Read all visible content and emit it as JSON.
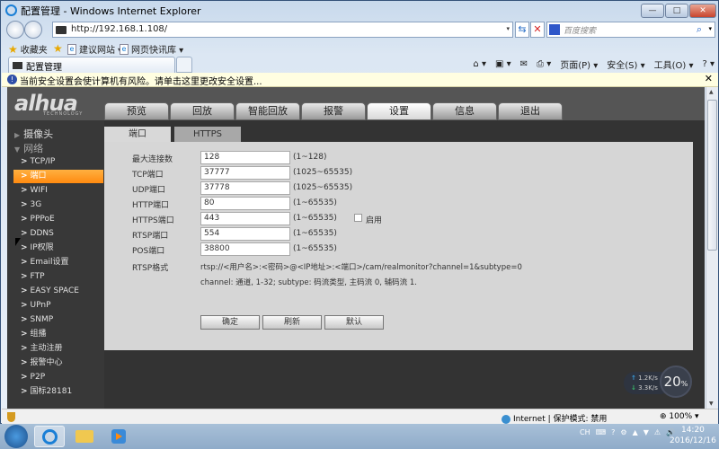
{
  "window": {
    "title": "配置管理 - Windows Internet Explorer",
    "min_label": "—",
    "max_label": "□",
    "close_label": "✕"
  },
  "nav": {
    "back_icon": "◀",
    "forward_icon": "▶",
    "url": "http://192.168.1.108/",
    "dropdown": "▾",
    "refresh_icon": "⇆",
    "stop_icon": "✕",
    "search_placeholder": "百度搜索",
    "search_icon": "⌕"
  },
  "favorites": {
    "favorites_label": "收藏夹",
    "items": [
      {
        "label": "建议网站 ▾"
      },
      {
        "label": "网页快讯库 ▾"
      }
    ]
  },
  "tab": {
    "title": "配置管理"
  },
  "command_bar": {
    "home": "⌂ ▾",
    "feeds": "▣ ▾",
    "mail": "✉",
    "print": "⎙ ▾",
    "page": "页面(P) ▾",
    "safety": "安全(S) ▾",
    "tools": "工具(O) ▾",
    "help": "? ▾"
  },
  "infobar": {
    "icon": "!",
    "text": "当前安全设置会使计算机有风险。请单击这里更改安全设置...",
    "close": "✕"
  },
  "app": {
    "logo": "alhua",
    "logo_sub": "TECHNOLOGY",
    "top_nav": [
      {
        "label": "预览",
        "active": false
      },
      {
        "label": "回放",
        "active": false
      },
      {
        "label": "智能回放",
        "active": false
      },
      {
        "label": "报警",
        "active": false
      },
      {
        "label": "设置",
        "active": true
      },
      {
        "label": "信息",
        "active": false
      },
      {
        "label": "退出",
        "active": false
      }
    ],
    "sidebar": {
      "sections": [
        {
          "label": "摄像头",
          "icon": "▶"
        },
        {
          "label": "网络",
          "icon": "▼"
        }
      ],
      "items": [
        {
          "label": "TCP/IP",
          "active": false
        },
        {
          "label": "端口",
          "active": true
        },
        {
          "label": "WIFI",
          "active": false
        },
        {
          "label": "3G",
          "active": false
        },
        {
          "label": "PPPoE",
          "active": false
        },
        {
          "label": "DDNS",
          "active": false
        },
        {
          "label": "IP权限",
          "active": false
        },
        {
          "label": "Email设置",
          "active": false
        },
        {
          "label": "FTP",
          "active": false
        },
        {
          "label": "EASY SPACE",
          "active": false
        },
        {
          "label": "UPnP",
          "active": false
        },
        {
          "label": "SNMP",
          "active": false
        },
        {
          "label": "组播",
          "active": false
        },
        {
          "label": "主动注册",
          "active": false
        },
        {
          "label": "报警中心",
          "active": false
        },
        {
          "label": "P2P",
          "active": false
        },
        {
          "label": "国标28181",
          "active": false
        }
      ],
      "chevron": ">"
    },
    "sub_tabs": [
      {
        "label": "端口",
        "active": true
      },
      {
        "label": "HTTPS",
        "active": false
      }
    ],
    "form": {
      "rows": [
        {
          "label": "最大连接数",
          "value": "128",
          "range": "(1~128)"
        },
        {
          "label": "TCP端口",
          "value": "37777",
          "range": "(1025~65535)"
        },
        {
          "label": "UDP端口",
          "value": "37778",
          "range": "(1025~65535)"
        },
        {
          "label": "HTTP端口",
          "value": "80",
          "range": "(1~65535)"
        },
        {
          "label": "HTTPS端口",
          "value": "443",
          "range": "(1~65535)",
          "checkbox_label": "启用",
          "checked": false
        },
        {
          "label": "RTSP端口",
          "value": "554",
          "range": "(1~65535)"
        },
        {
          "label": "POS端口",
          "value": "38800",
          "range": "(1~65535)"
        }
      ],
      "rtsp_label": "RTSP格式",
      "rtsp_format": "rtsp://<用户名>:<密码>@<IP地址>:<端口>/cam/realmonitor?channel=1&subtype=0",
      "rtsp_note": "channel: 通道, 1-32; subtype: 码流类型, 主码流 0, 辅码流 1.",
      "buttons": {
        "ok": "确定",
        "refresh": "刷新",
        "default": "默认"
      }
    }
  },
  "speed_widget": {
    "upload": "1.2K/s",
    "download": "3.3K/s",
    "percent": "20",
    "percent_sign": "%"
  },
  "status_bar": {
    "zone": "Internet | 保护模式: 禁用",
    "zoom": "100%"
  },
  "taskbar": {
    "tray": [
      "CH",
      "⌨",
      "?",
      "⚙",
      "▲",
      "▼",
      "⚠",
      "🔊"
    ],
    "time": "14:20",
    "date": "2016/12/16"
  }
}
